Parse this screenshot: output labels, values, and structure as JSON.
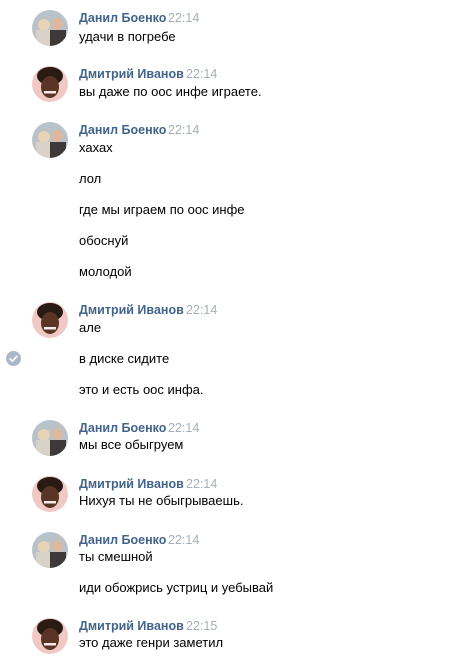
{
  "messages": [
    {
      "author": "Данил Боенко",
      "time": "22:14",
      "avatar_icon": "danil-avatar-icon",
      "lines": [
        "удачи в погребе"
      ]
    },
    {
      "author": "Дмитрий Иванов",
      "time": "22:14",
      "avatar_icon": "dmitry-avatar-icon",
      "lines": [
        "вы даже по оос инфе играете."
      ]
    },
    {
      "author": "Данил Боенко",
      "time": "22:14",
      "avatar_icon": "danil-avatar-icon",
      "lines": [
        "хахах",
        "лол",
        "где мы играем по оос инфе",
        "обоснуй",
        "молодой"
      ]
    },
    {
      "author": "Дмитрий Иванов",
      "time": "22:14",
      "avatar_icon": "dmitry-avatar-icon",
      "lines": [
        "але",
        "в диске сидите",
        "это и есть оос инфа."
      ]
    },
    {
      "author": "Данил Боенко",
      "time": "22:14",
      "avatar_icon": "danil-avatar-icon",
      "lines": [
        "мы все обыгруем"
      ]
    },
    {
      "author": "Дмитрий Иванов",
      "time": "22:14",
      "avatar_icon": "dmitry-avatar-icon",
      "lines": [
        "Нихуя ты не обыгрываешь."
      ]
    },
    {
      "author": "Данил Боенко",
      "time": "22:14",
      "avatar_icon": "danil-avatar-icon",
      "lines": [
        "ты смешной",
        "иди обожрись устриц и уебывай"
      ]
    },
    {
      "author": "Дмитрий Иванов",
      "time": "22:15",
      "avatar_icon": "dmitry-avatar-icon",
      "lines": [
        "это даже генри заметил"
      ]
    }
  ],
  "selection_icon": "checkmark-circle-icon",
  "colors": {
    "author": "#42648b",
    "time": "#a6afba",
    "check": "#aab7c9"
  }
}
